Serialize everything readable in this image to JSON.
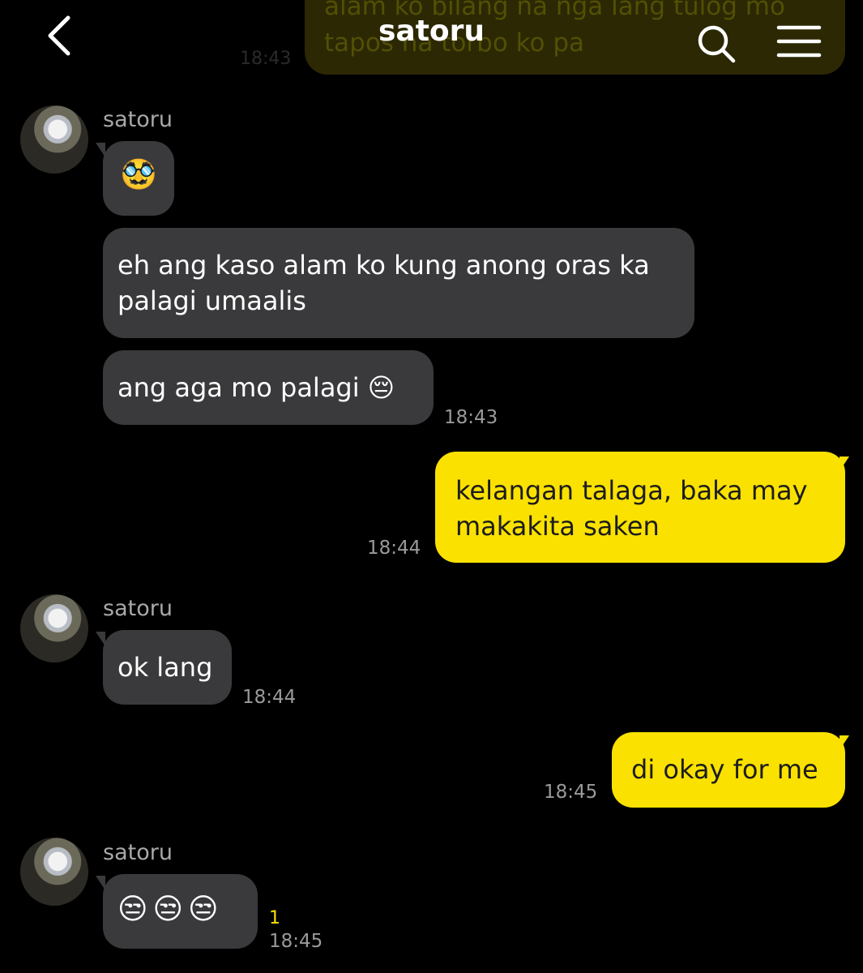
{
  "header": {
    "title": "satoru"
  },
  "scrolled_message": {
    "text": "alam ko bilang na nga lang tulog mo\ntapos na torbo ko pa",
    "time": "18:43"
  },
  "messages": [
    {
      "sender": "satoru",
      "bubble_1_emoji": "🥸",
      "bubble_2_text": "eh ang kaso alam ko kung anong oras ka palagi umaalis",
      "bubble_3_text": "ang aga mo palagi 😔",
      "time": "18:43"
    },
    {
      "text": "kelangan talaga, baka may makakita saken",
      "time": "18:44"
    },
    {
      "sender": "satoru",
      "text": "ok lang",
      "time": "18:44"
    },
    {
      "text": "di okay for me",
      "time": "18:45"
    },
    {
      "sender": "satoru",
      "text": "😒😒😒",
      "unread": "1",
      "time": "18:45"
    }
  ],
  "colors": {
    "background": "#000000",
    "incoming_bubble": "#3a3a3c",
    "outgoing_bubble": "#fae100",
    "timestamp": "#9a9a9a",
    "unread_count": "#fae100"
  }
}
